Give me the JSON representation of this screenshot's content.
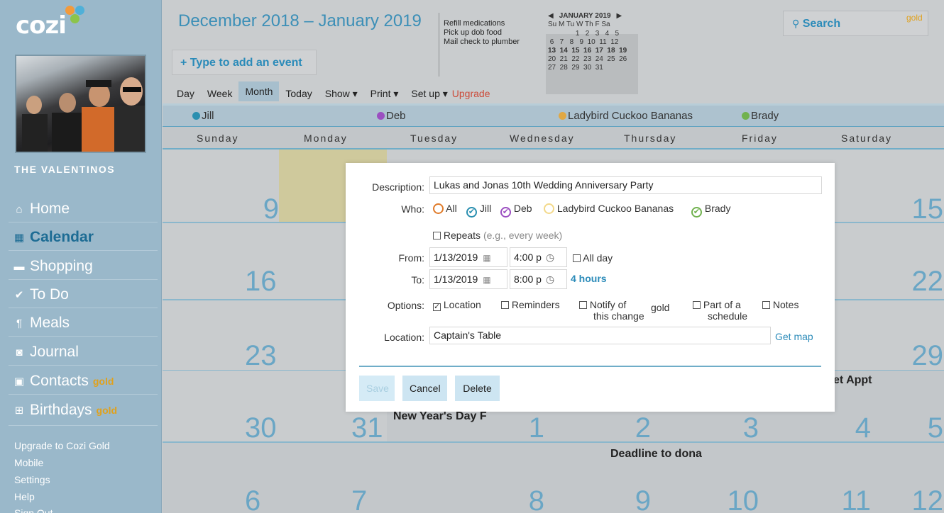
{
  "app": {
    "logo_text": "cozi"
  },
  "sidebar": {
    "family_name": "THE VALENTINOS",
    "nav": [
      {
        "label": "Home",
        "icon": "home-icon",
        "gold": ""
      },
      {
        "label": "Calendar",
        "icon": "calendar-icon",
        "gold": ""
      },
      {
        "label": "Shopping",
        "icon": "cart-icon",
        "gold": ""
      },
      {
        "label": "To Do",
        "icon": "checkmark-icon",
        "gold": ""
      },
      {
        "label": "Meals",
        "icon": "utensils-icon",
        "gold": ""
      },
      {
        "label": "Journal",
        "icon": "camera-icon",
        "gold": ""
      },
      {
        "label": "Contacts",
        "icon": "address-book-icon",
        "gold": "gold"
      },
      {
        "label": "Birthdays",
        "icon": "gift-icon",
        "gold": "gold"
      }
    ],
    "footer_links": [
      "Upgrade to Cozi Gold",
      "Mobile",
      "Settings",
      "Help",
      "Sign Out"
    ]
  },
  "header": {
    "title": "December 2018 – January 2019",
    "add_event_label": "+ Type to add an event",
    "todo_lines": [
      "Refill medications",
      "Pick up dob food",
      "Mail check to plumber"
    ],
    "tabs": [
      "Day",
      "Week",
      "Month",
      "Today"
    ],
    "menus": [
      "Show ▾",
      "Print ▾",
      "Set up ▾"
    ],
    "upgrade_label": "Upgrade",
    "search_label": "Search",
    "search_badge": "gold"
  },
  "mini_calendar": {
    "title": "JANUARY 2019",
    "dow": "Su M Tu W Th F Sa",
    "rows": [
      "              1   2   3   4   5",
      " 6   7   8   9  10  11  12",
      "13  14  15  16  17  18  19",
      "20  21  22  23  24  25  26",
      "27  28  29  30  31"
    ]
  },
  "people": [
    {
      "name": "Jill",
      "color": "#2a8fb0"
    },
    {
      "name": "Deb",
      "color": "#9b4fc1"
    },
    {
      "name": "Ladybird Cuckoo Bananas",
      "color": "#e0a845"
    },
    {
      "name": "Brady",
      "color": "#71b24f"
    }
  ],
  "calendar": {
    "day_names": [
      "Sunday",
      "Monday",
      "Tuesday",
      "Wednesday",
      "Thursday",
      "Friday",
      "Saturday"
    ],
    "weeks": [
      [
        "",
        "9",
        "",
        "",
        "",
        "",
        "15"
      ],
      [
        "16",
        "",
        "",
        "",
        "",
        "",
        "22"
      ],
      [
        "23",
        "",
        "",
        "",
        "",
        "",
        "29"
      ],
      [
        "30",
        "31",
        "1",
        "2",
        "3",
        "4",
        "5"
      ],
      [
        "6",
        "7",
        "8",
        "9",
        "10",
        "11",
        "12"
      ]
    ],
    "events": {
      "new_years": "New Year's Day F",
      "deadline": "Deadline to dona",
      "appt": "et Appt"
    }
  },
  "dialog": {
    "labels": {
      "description": "Description:",
      "who": "Who:",
      "from": "From:",
      "to": "To:",
      "options": "Options:",
      "location": "Location:"
    },
    "description_value": "Lukas and Jonas 10th Wedding Anniversary Party",
    "who_options": [
      "All",
      "Jill",
      "Deb",
      "Ladybird Cuckoo Bananas",
      "Brady"
    ],
    "repeats_label": "Repeats",
    "repeats_hint": "(e.g., every week)",
    "from_date": "1/13/2019",
    "from_time": "4:00 p",
    "all_day_label": "All day",
    "to_date": "1/13/2019",
    "to_time": "8:00 p",
    "duration": "4 hours",
    "opt_location": "Location",
    "opt_reminders": "Reminders",
    "opt_notify_1": "Notify of",
    "opt_notify_2": "this change",
    "opt_notify_gold": "gold",
    "opt_part_1": "Part of a",
    "opt_part_2": "schedule",
    "opt_notes": "Notes",
    "location_value": "Captain's Table",
    "get_map": "Get map",
    "save": "Save",
    "cancel": "Cancel",
    "delete": "Delete"
  }
}
